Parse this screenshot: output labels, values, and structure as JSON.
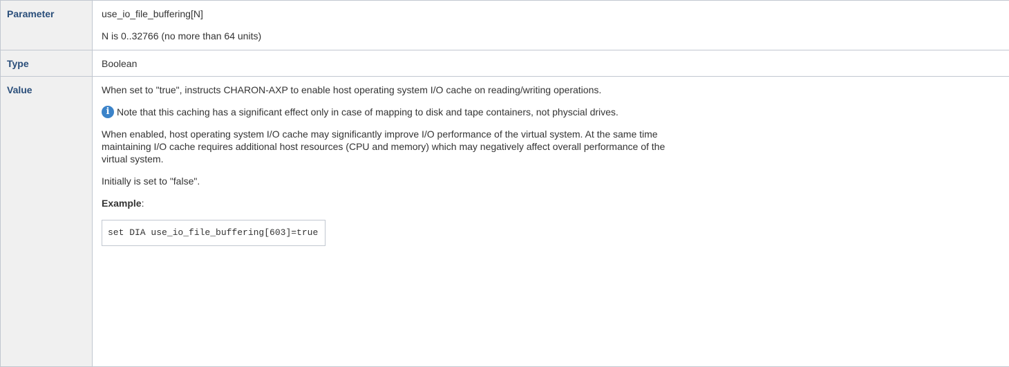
{
  "rows": {
    "parameter": {
      "label": "Parameter",
      "name": "use_io_file_buffering[N]",
      "range": "N is 0..32766 (no more than 64 units)"
    },
    "type": {
      "label": "Type",
      "value": "Boolean"
    },
    "value": {
      "label": "Value",
      "intro": "When set to \"true\", instructs CHARON-AXP to enable host operating system I/O cache on reading/writing operations.",
      "note": {
        "icon": "info-icon",
        "text": "Note that this caching has a significant effect only in case of mapping to disk and tape containers, not physcial drives."
      },
      "details_line1": "When enabled, host operating system I/O cache may significantly improve I/O performance of the virtual system. At the same time",
      "details_line2": "maintaining I/O cache requires additional host resources (CPU and memory) which may negatively affect overall performance of the",
      "details_line3": "virtual system.",
      "initial": "Initially is set to \"false\".",
      "example_label": "Example",
      "example_suffix": ":",
      "example_code": "set DIA use_io_file_buffering[603]=true"
    }
  },
  "colors": {
    "header_bg": "#f0f0f0",
    "header_text": "#2a4e7a",
    "border": "#c1c7d0",
    "info_icon": "#3b83c9"
  }
}
